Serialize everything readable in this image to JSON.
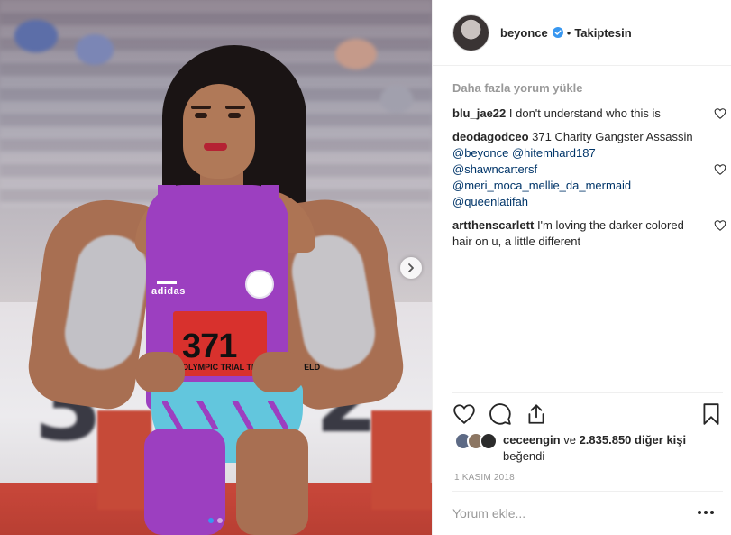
{
  "post": {
    "author": {
      "username": "beyonce",
      "verified": true,
      "separator": "•",
      "follow_status": "Takiptesin"
    },
    "media": {
      "bib_number": "371",
      "bib_caption": "OLYMPIC TRIAL TRACK AND FIELD",
      "brand_text": "adidas",
      "slide_count": 2,
      "active_slide": 1
    },
    "load_more_label": "Daha fazla yorum yükle",
    "comments": [
      {
        "user": "blu_jae22",
        "text": "I don't understand who this is"
      },
      {
        "user": "deodagodceo",
        "text": "371 Charity Gangster Assassin",
        "mentions": [
          "@beyonce",
          "@hitemhard187",
          "@shawncartersf",
          "@meri_moca_mellie_da_mermaid",
          "@queenlatifah"
        ]
      },
      {
        "user": "artthenscarlett",
        "text": "I'm loving the darker colored hair on u, a little different"
      }
    ],
    "likes": {
      "first_user": "ceceengin",
      "connector": "ve",
      "others_count": "2.835.850",
      "others_label": "diğer kişi",
      "suffix": "beğendi"
    },
    "timestamp": "1 KASIM 2018",
    "comment_placeholder": "Yorum ekle...",
    "icons": {
      "like": "heart-icon",
      "comment": "comment-icon",
      "share": "share-icon",
      "save": "bookmark-icon",
      "more": "more-options-icon",
      "next": "chevron-right-icon",
      "verified": "verified-badge-icon"
    },
    "colors": {
      "link": "#003569",
      "verified_blue": "#3897f0",
      "muted": "#999999",
      "text": "#262626"
    }
  }
}
